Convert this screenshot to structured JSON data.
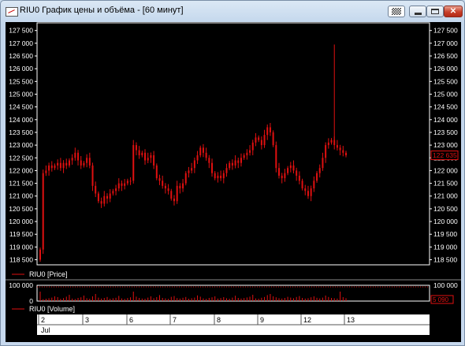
{
  "window": {
    "title": "RIU0 График цены и объёма - [60 минут]"
  },
  "price_panel": {
    "legend": "RIU0 [Price]",
    "current_price_label": "122 635"
  },
  "volume_panel": {
    "legend": "RIU0 [Volume]",
    "current_volume_label": "5 090"
  },
  "x_axis": {
    "day_labels": [
      "2",
      "3",
      "6",
      "7",
      "8",
      "9",
      "12",
      "13"
    ],
    "month_label": "Jul"
  },
  "colors": {
    "candle": "#e01010",
    "background": "#000000",
    "axis": "#ffffff",
    "label_border": "#e01010"
  },
  "chart_data": [
    {
      "type": "line",
      "title": "",
      "xlabel": "",
      "ylabel": "",
      "y_ticks": [
        "118 500",
        "119 000",
        "119 500",
        "120 000",
        "120 500",
        "121 000",
        "121 500",
        "122 000",
        "122 500",
        "123 000",
        "123 500",
        "124 000",
        "124 500",
        "125 000",
        "125 500",
        "126 000",
        "126 500",
        "127 000",
        "127 500"
      ],
      "ylim": [
        118300,
        127800
      ],
      "days": [
        "2",
        "3",
        "6",
        "7",
        "8",
        "9",
        "12",
        "13"
      ],
      "series": [
        {
          "name": "RIU0 [Price]",
          "values": [
            118900,
            121900,
            122000,
            122200,
            122100,
            122200,
            122300,
            122100,
            122300,
            122200,
            122400,
            122500,
            122700,
            122400,
            122200,
            122300,
            122500,
            122200,
            121400,
            121100,
            120800,
            120700,
            121000,
            120900,
            121100,
            121200,
            121300,
            121500,
            121400,
            121500,
            121600,
            121600,
            123000,
            122800,
            122600,
            122700,
            122400,
            122500,
            122600,
            122200,
            121700,
            121600,
            121400,
            121300,
            121200,
            120900,
            120800,
            121400,
            121300,
            121500,
            121900,
            122000,
            122100,
            122400,
            122600,
            122900,
            122700,
            122500,
            122300,
            121900,
            121700,
            121800,
            121700,
            121900,
            122100,
            122300,
            122200,
            122400,
            122300,
            122500,
            122600,
            122700,
            122800,
            123100,
            123300,
            123200,
            123000,
            123400,
            123700,
            123500,
            123000,
            122100,
            121800,
            121700,
            121900,
            122100,
            122200,
            122000,
            121800,
            121600,
            121300,
            121200,
            121000,
            121300,
            121600,
            121900,
            122100,
            122500,
            123000,
            123100,
            123200,
            123000,
            122900,
            122800,
            122700,
            122600
          ]
        }
      ]
    },
    {
      "type": "bar",
      "title": "",
      "xlabel": "",
      "ylabel": "",
      "y_ticks": [
        "0",
        "100 000"
      ],
      "ylim": [
        0,
        100000
      ],
      "series": [
        {
          "name": "RIU0 [Volume]",
          "values": [
            60000,
            12000,
            15000,
            18000,
            22000,
            30000,
            25000,
            14000,
            19000,
            28000,
            40000,
            16000,
            13000,
            20000,
            24000,
            35000,
            18000,
            15000,
            30000,
            45000,
            22000,
            16000,
            20000,
            26000,
            15000,
            18000,
            21000,
            33000,
            17000,
            14000,
            19000,
            24000,
            60000,
            28000,
            20000,
            16000,
            15000,
            22000,
            30000,
            18000,
            25000,
            38000,
            20000,
            17000,
            14000,
            27000,
            32000,
            19000,
            16000,
            21000,
            26000,
            15000,
            18000,
            22000,
            36000,
            28000,
            17000,
            14000,
            20000,
            24000,
            30000,
            16000,
            19000,
            25000,
            18000,
            15000,
            22000,
            34000,
            20000,
            16000,
            19000,
            23000,
            28000,
            40000,
            17000,
            15000,
            21000,
            26000,
            38000,
            45000,
            30000,
            24000,
            18000,
            16000,
            20000,
            27000,
            22000,
            18000,
            26000,
            32000,
            20000,
            16000,
            18000,
            24000,
            30000,
            21000,
            17000,
            22000,
            35000,
            26000,
            20000,
            18000,
            16000,
            60000,
            25000,
            18000
          ]
        }
      ]
    }
  ]
}
